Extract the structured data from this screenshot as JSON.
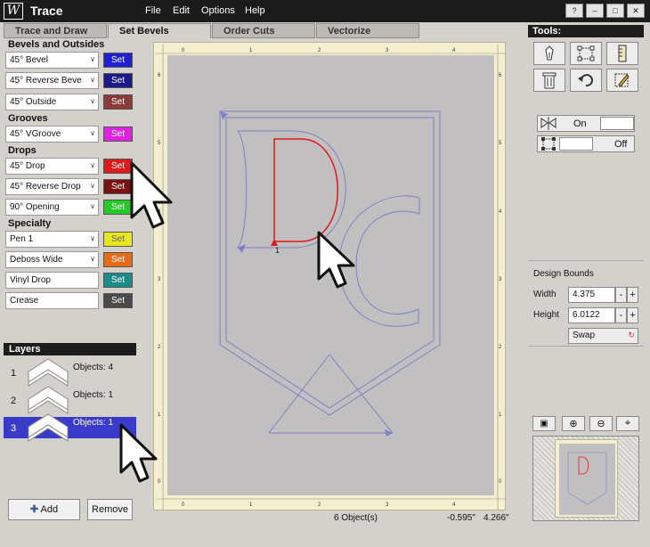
{
  "app": {
    "title": "Trace",
    "logo_text": "W"
  },
  "menu": [
    "File",
    "Edit",
    "Options",
    "Help"
  ],
  "tabs": [
    "Trace and Draw",
    "Set Bevels",
    "Order Cuts",
    "Vectorize"
  ],
  "bevels": {
    "section_bevels": "Bevels and Outsides",
    "section_grooves": "Grooves",
    "section_drops": "Drops",
    "section_specialty": "Specialty",
    "set_label": "Set",
    "rows": [
      {
        "label": "45° Bevel",
        "color": "#1f1fd6"
      },
      {
        "label": "45° Reverse Beve",
        "color": "#1a1a8c"
      },
      {
        "label": "45° Outside",
        "color": "#8c3a3a"
      },
      {
        "label": "45° VGroove",
        "color": "#e21fe2"
      },
      {
        "label": "45° Drop",
        "color": "#e01a1a"
      },
      {
        "label": "45° Reverse Drop",
        "color": "#7a1212"
      },
      {
        "label": "90° Opening",
        "color": "#22cc22"
      },
      {
        "label": "Pen 1",
        "color": "#e8e818"
      },
      {
        "label": "Deboss Wide",
        "color": "#e86a12"
      },
      {
        "label": "Vinyl Drop",
        "color": "#1a8c8c"
      },
      {
        "label": "Crease",
        "color": "#4a4a4a"
      }
    ]
  },
  "layers": {
    "title": "Layers",
    "items": [
      {
        "num": "1",
        "objects": "Objects: 4"
      },
      {
        "num": "2",
        "objects": "Objects: 1"
      },
      {
        "num": "3",
        "objects": "Objects: 1"
      }
    ],
    "add_label": "Add",
    "remove_label": "Remove"
  },
  "ruler": {
    "top": [
      "0",
      "1",
      "2",
      "3",
      "4"
    ],
    "side": [
      "6",
      "5",
      "4",
      "3",
      "2",
      "1",
      "0"
    ]
  },
  "canvas": {
    "point_label": "1"
  },
  "status": {
    "objects": "6 Object(s)",
    "x": "-0.595\"",
    "y": "4.266\""
  },
  "tools": {
    "title": "Tools:",
    "toggle_on": "On",
    "toggle_off": "Off",
    "design_bounds": "Design Bounds",
    "width_label": "Width",
    "width_value": "4.375",
    "height_label": "Height",
    "height_value": "6.0122",
    "swap_label": "Swap",
    "minus": "-",
    "plus": "+"
  },
  "window_buttons": [
    "?",
    "–",
    "□",
    "✕"
  ]
}
